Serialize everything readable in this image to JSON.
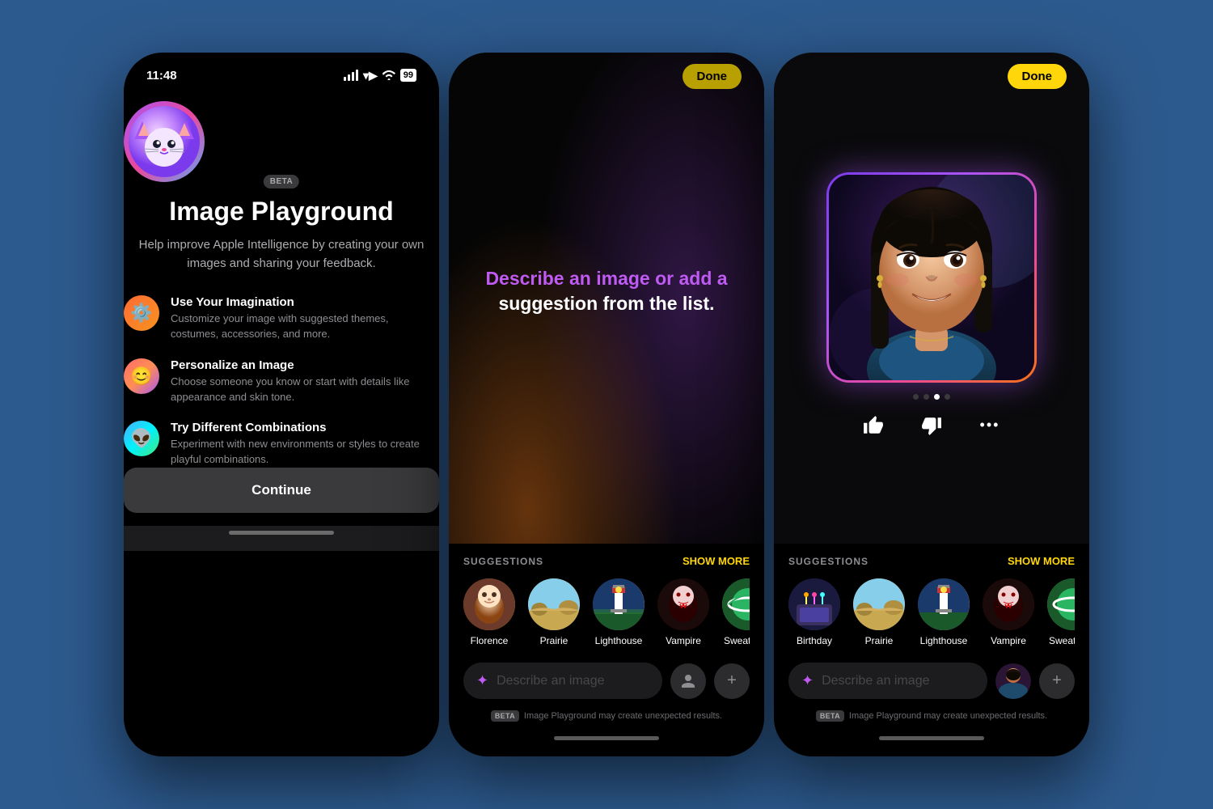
{
  "background": "#2d5a8e",
  "phones": [
    {
      "id": "phone1",
      "status_bar": {
        "time": "11:48",
        "signal": true,
        "wifi": true,
        "battery": "99"
      },
      "avatar": {
        "emoji": "🐱",
        "beta_label": "BETA"
      },
      "title": "Image Playground",
      "subtitle": "Help improve Apple Intelligence by creating your own images and sharing your feedback.",
      "features": [
        {
          "icon": "⚙️",
          "icon_type": "gear",
          "title": "Use Your Imagination",
          "desc": "Customize your image with suggested themes, costumes, accessories, and more."
        },
        {
          "icon": "😊",
          "icon_type": "person",
          "title": "Personalize an Image",
          "desc": "Choose someone you know or start with details like appearance and skin tone."
        },
        {
          "icon": "👽",
          "icon_type": "alien",
          "title": "Try Different Combinations",
          "desc": "Experiment with new environments or styles to create playful combinations."
        }
      ],
      "continue_label": "Continue"
    },
    {
      "id": "phone2",
      "status_bar": {
        "time": "",
        "battery": ""
      },
      "done_label": "Done",
      "done_style": "olive",
      "describe_text_colored": "Describe an image or add a",
      "describe_text_white": "suggestion from the list.",
      "suggestions_label": "SUGGESTIONS",
      "show_more_label": "SHOW MORE",
      "suggestions": [
        {
          "label": "Florence",
          "thumb_class": "thumb-florence",
          "emoji": "🎨"
        },
        {
          "label": "Prairie",
          "thumb_class": "thumb-prairie",
          "emoji": "🌾"
        },
        {
          "label": "Lighthouse",
          "thumb_class": "thumb-lighthouse",
          "emoji": "🏠"
        },
        {
          "label": "Vampire",
          "thumb_class": "thumb-vampire",
          "emoji": "🦷"
        },
        {
          "label": "Sweatband",
          "thumb_class": "thumb-sweatband",
          "emoji": "🎾"
        }
      ],
      "input_placeholder": "Describe an image",
      "beta_label": "BETA",
      "disclaimer": "Image Playground may create unexpected results."
    },
    {
      "id": "phone3",
      "status_bar": {
        "time": "",
        "battery": ""
      },
      "done_label": "Done",
      "done_style": "yellow",
      "suggestions_label": "SUGGESTIONS",
      "show_more_label": "SHOW MORE",
      "suggestions": [
        {
          "label": "Birthday",
          "thumb_class": "thumb-birthday",
          "emoji": "🎂"
        },
        {
          "label": "Prairie",
          "thumb_class": "thumb-prairie",
          "emoji": "🌾"
        },
        {
          "label": "Lighthouse",
          "thumb_class": "thumb-lighthouse",
          "emoji": "🏠"
        },
        {
          "label": "Vampire",
          "thumb_class": "thumb-vampire",
          "emoji": "🦷"
        },
        {
          "label": "Sweatband",
          "thumb_class": "thumb-sweatband",
          "emoji": "🎾"
        }
      ],
      "input_placeholder": "Describe an image",
      "beta_label": "BETA",
      "disclaimer": "Image Playground may create unexpected results.",
      "dots": [
        false,
        false,
        true,
        false
      ],
      "actions": [
        "👍",
        "👎",
        "•••"
      ]
    }
  ]
}
